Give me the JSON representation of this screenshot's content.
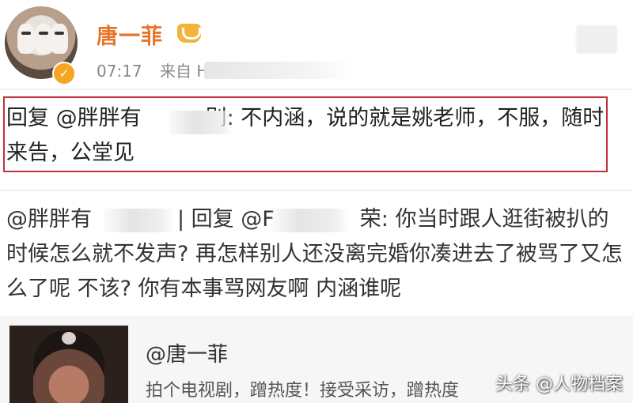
{
  "post": {
    "username": "唐一菲",
    "verified_icon": "verified-badge",
    "vip_icon": "vip-crown-icon",
    "time": "07:17",
    "source_prefix": "来自 H",
    "reply_text": "回复 @胖胖有　　　别: 不内涵，说的就是姚老师，不服，随时来告，公堂见"
  },
  "quoted_comment": {
    "text": "@胖胖有　　　　| 回复 @F　　　　荣: 你当时跟人逛街被扒的时候怎么就不发声? 再怎样别人还没离完婚你凑进去了被骂了又怎么了呢 不该? 你有本事骂网友啊 内涵谁呢"
  },
  "repost_card": {
    "username": "@唐一菲",
    "text": "拍个电视剧，蹭热度！接受采访，蹭热度"
  },
  "watermark": "头条 @人物档案",
  "colors": {
    "username": "#e8742a",
    "highlight_border": "#c0303a",
    "verified": "#f5a623"
  }
}
